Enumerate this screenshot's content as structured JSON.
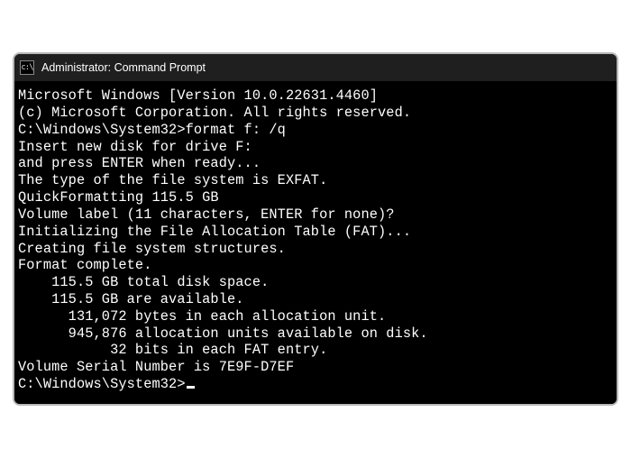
{
  "titlebar": {
    "icon_label": "cmd-icon",
    "icon_glyph": "c:\\",
    "title": "Administrator: Command Prompt"
  },
  "lines": {
    "l0": "Microsoft Windows [Version 10.0.22631.4460]",
    "l1": "(c) Microsoft Corporation. All rights reserved.",
    "l2": "",
    "l3a": "C:\\Windows\\System32>",
    "l3b": "format f: /q",
    "l4": "Insert new disk for drive F:",
    "l5": "and press ENTER when ready...",
    "l6": "The type of the file system is EXFAT.",
    "l7": "QuickFormatting 115.5 GB",
    "l8": "Volume label (11 characters, ENTER for none)?",
    "l9": "Initializing the File Allocation Table (FAT)...",
    "l10": "Creating file system structures.",
    "l11": "Format complete.",
    "l12": "    115.5 GB total disk space.",
    "l13": "    115.5 GB are available.",
    "l14": "",
    "l15": "      131,072 bytes in each allocation unit.",
    "l16": "      945,876 allocation units available on disk.",
    "l17": "",
    "l18": "           32 bits in each FAT entry.",
    "l19": "",
    "l20": "Volume Serial Number is 7E9F-D7EF",
    "l21": "",
    "l22": "C:\\Windows\\System32>"
  }
}
